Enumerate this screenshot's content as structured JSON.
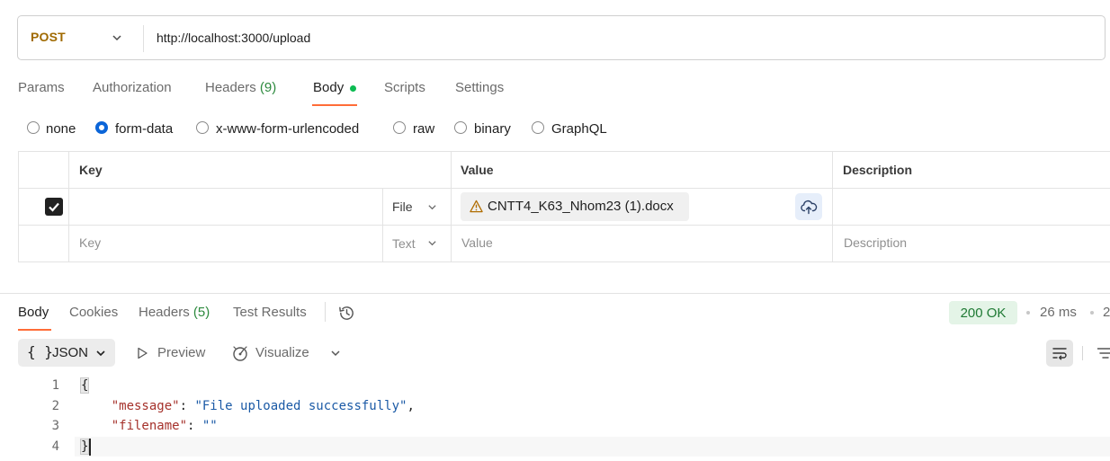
{
  "request": {
    "method": "POST",
    "url": "http://localhost:3000/upload"
  },
  "request_tabs": {
    "params": "Params",
    "authorization": "Authorization",
    "headers": "Headers",
    "headers_count": "(9)",
    "body": "Body",
    "scripts": "Scripts",
    "settings": "Settings"
  },
  "body_types": {
    "none": "none",
    "form_data": "form-data",
    "urlencoded": "x-www-form-urlencoded",
    "raw": "raw",
    "binary": "binary",
    "graphql": "GraphQL",
    "selected": "form-data"
  },
  "form_table": {
    "headers": {
      "key": "Key",
      "value": "Value",
      "description": "Description"
    },
    "rows": [
      {
        "checked": true,
        "key": "",
        "type": "File",
        "file_name": "CNTT4_K63_Nhom23 (1).docx",
        "description": ""
      }
    ],
    "placeholder_row": {
      "key": "Key",
      "type": "Text",
      "value": "Value",
      "description": "Description"
    }
  },
  "response_tabs": {
    "body": "Body",
    "cookies": "Cookies",
    "headers": "Headers",
    "headers_count": "(5)",
    "test_results": "Test Results"
  },
  "response_meta": {
    "status": "200 OK",
    "time": "26 ms",
    "truncated": "2"
  },
  "response_toolbar": {
    "format_braces": "{ }",
    "format": "JSON",
    "preview": "Preview",
    "visualize": "Visualize"
  },
  "response_body": {
    "line_numbers": [
      "1",
      "2",
      "3",
      "4"
    ],
    "open_brace": "{",
    "close_brace": "}",
    "message_key": "\"message\"",
    "message_value": "\"File uploaded successfully\"",
    "filename_key": "\"filename\"",
    "filename_value": "\"\""
  },
  "colors": {
    "accent": "#ff6c37",
    "method_post": "#a06a00",
    "status_ok": "#1f7a34",
    "radio_selected": "#0b65d8"
  },
  "icons": [
    "chevron-down-icon",
    "warning-icon",
    "cloud-upload-icon",
    "history-icon",
    "play-icon",
    "visualize-icon",
    "wrap-lines-icon",
    "filter-icon"
  ]
}
